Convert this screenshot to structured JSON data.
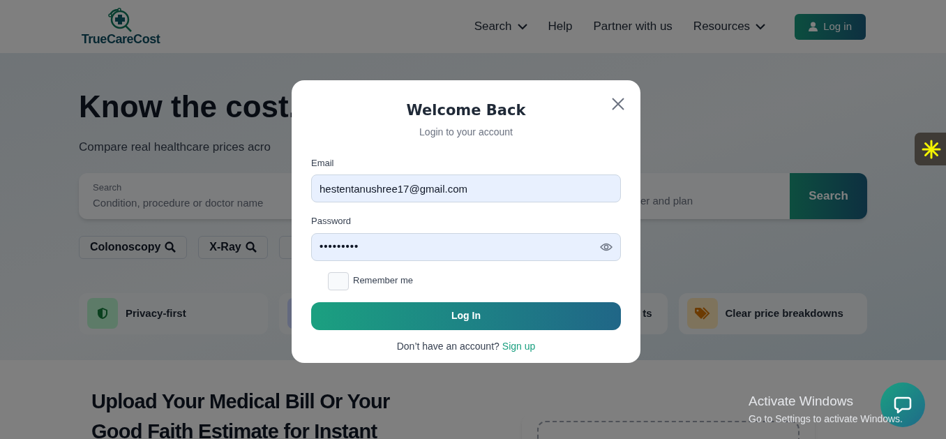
{
  "header": {
    "logo": "TrueCareCost",
    "nav": [
      {
        "label": "Search",
        "dropdown": true
      },
      {
        "label": "Help",
        "dropdown": false
      },
      {
        "label": "Partner with us",
        "dropdown": false
      },
      {
        "label": "Resources",
        "dropdown": true
      }
    ],
    "login_button": "Log in"
  },
  "hero": {
    "title": "Know the cost.",
    "subtitle": "Compare real healthcare prices acro",
    "search": {
      "label": "Search",
      "placeholder": "Condition, procedure or doctor name",
      "second_placeholder": "er and plan",
      "button": "Search"
    },
    "chips": [
      {
        "label": "Colonoscopy"
      },
      {
        "label": "X-Ray"
      }
    ],
    "features": [
      {
        "label": "Privacy-first",
        "tile": true
      },
      {
        "tile": true
      },
      {
        "label": "ts",
        "tile": false
      },
      {
        "label": "Clear price breakdowns",
        "tile": true
      }
    ]
  },
  "upload": {
    "title_lines": [
      "Upload Your Medical Bill Or Your",
      "Good Faith Estimate for Instant"
    ]
  },
  "login_modal": {
    "title": "Welcome Back",
    "subtitle": "Login to your account",
    "email": {
      "label": "Email",
      "value": "hestentanushree17@gmail.com"
    },
    "password": {
      "label": "Password",
      "value": "•••••••••"
    },
    "remember": {
      "label": "Remember me",
      "checked": false
    },
    "button": "Log In",
    "footer": {
      "text": "Don’t have an account?",
      "link": "Sign up"
    }
  },
  "system_notice": {
    "title": "Activate Windows",
    "text": "Go to Settings to activate Windows."
  }
}
